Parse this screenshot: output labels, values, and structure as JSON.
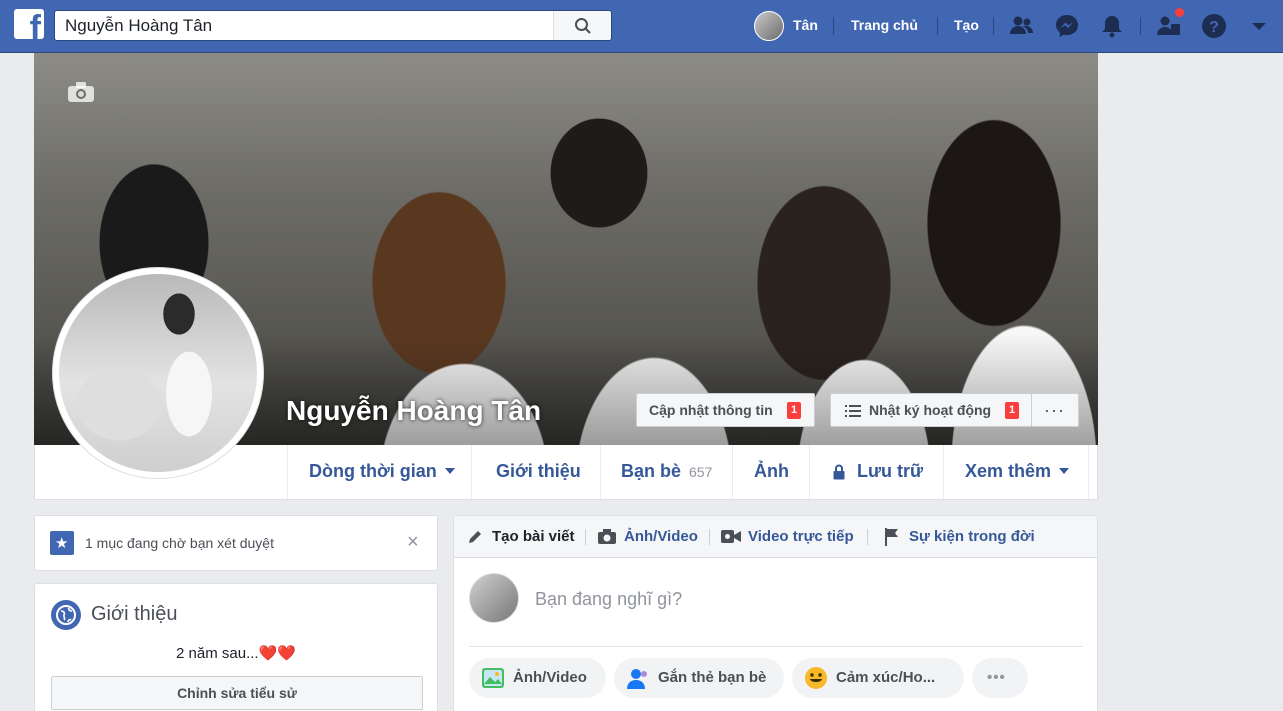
{
  "topbar": {
    "logo": "f",
    "search_value": "Nguyễn Hoàng Tân",
    "user_name": "Tân",
    "home_label": "Trang chủ",
    "create_label": "Tạo",
    "icons": [
      "friends-icon",
      "messenger-icon",
      "notifications-bell-icon",
      "friend-requests-icon",
      "help-icon",
      "account-menu-caret-icon"
    ]
  },
  "profile": {
    "name": "Nguyễn Hoàng Tân",
    "update_info_label": "Cập nhật thông tin",
    "update_info_badge": "1",
    "activity_log_label": "Nhật ký hoạt động",
    "activity_log_badge": "1",
    "more_label": "···"
  },
  "timeline_nav": {
    "timeline": "Dòng thời gian",
    "about": "Giới thiệu",
    "friends": "Bạn bè",
    "friends_count": "657",
    "photos": "Ảnh",
    "archive": "Lưu trữ",
    "more": "Xem thêm"
  },
  "pending": {
    "text": "1 mục đang chờ bạn xét duyệt",
    "close": "×"
  },
  "about_card": {
    "title": "Giới thiệu",
    "bio": "2 năm sau...",
    "bio_emoji": "❤️❤️",
    "edit_bio_label": "Chỉnh sửa tiểu sử"
  },
  "composer": {
    "tabs": {
      "create_post": "Tạo bài viết",
      "photo_video": "Ảnh/Video",
      "live_video": "Video trực tiếp",
      "life_event": "Sự kiện trong đời"
    },
    "placeholder": "Bạn đang nghĩ gì?",
    "actions": {
      "photo_video": "Ảnh/Video",
      "tag_friends": "Gắn thẻ bạn bè",
      "feeling": "Cảm xúc/Ho...",
      "more": "•••"
    }
  },
  "colors": {
    "brand_blue": "#4267b2",
    "link_blue": "#365899",
    "badge_red": "#fa3e3e",
    "page_bg": "#e9ebee"
  }
}
